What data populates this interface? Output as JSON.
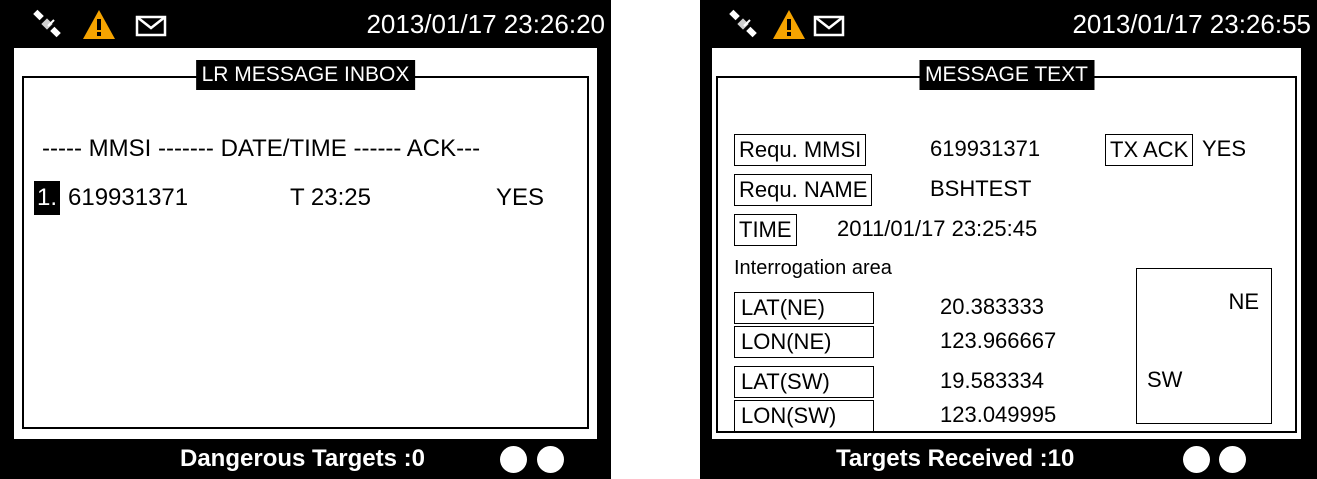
{
  "left_screen": {
    "status": {
      "icons": [
        "satellite-icon",
        "warning-icon",
        "envelope-icon"
      ],
      "datetime": "2013/01/17 23:26:20"
    },
    "inbox": {
      "title": "LR MESSAGE INBOX",
      "header": "----- MMSI ------- DATE/TIME ------ ACK---",
      "rows": [
        {
          "index": "1.",
          "mmsi": "619931371",
          "time": "T 23:25",
          "ack": "YES"
        }
      ]
    },
    "footer": {
      "label": "Dangerous Targets :0",
      "indicators": [
        "on",
        "on"
      ]
    }
  },
  "right_screen": {
    "status": {
      "icons": [
        "satellite-icon",
        "warning-icon",
        "envelope-icon"
      ],
      "datetime": "2013/01/17 23:26:55"
    },
    "message": {
      "title": "MESSAGE TEXT",
      "requ_mmsi_label": "Requ. MMSI",
      "requ_mmsi_value": "619931371",
      "tx_ack_label": "TX ACK",
      "tx_ack_value": "YES",
      "requ_name_label": "Requ. NAME",
      "requ_name_value": "BSHTEST",
      "time_label": "TIME",
      "time_value": "2011/01/17 23:25:45",
      "area_heading": "Interrogation area",
      "coords": [
        {
          "label": "LAT(NE)",
          "value": "20.383333"
        },
        {
          "label": "LON(NE)",
          "value": "123.966667"
        },
        {
          "label": "LAT(SW)",
          "value": "19.583334"
        },
        {
          "label": "LON(SW)",
          "value": "123.049995"
        }
      ],
      "area_ne": "NE",
      "area_sw": "SW"
    },
    "footer": {
      "label": "Targets Received :10",
      "indicators": [
        "on",
        "on"
      ]
    }
  },
  "colors": {
    "bezel": "#000000",
    "screen": "#ffffff",
    "warning": "#f5a300",
    "indicator": "#ffffff"
  }
}
